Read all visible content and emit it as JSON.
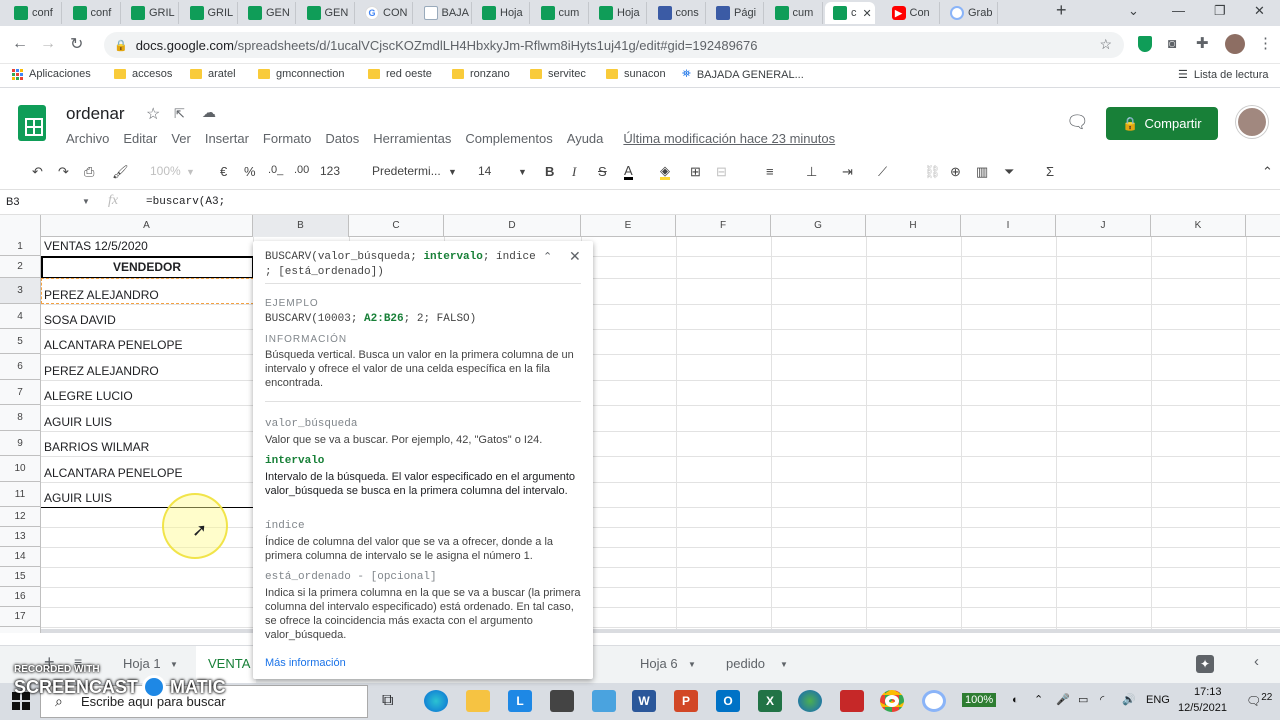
{
  "browser": {
    "tabs": [
      {
        "icon": "sheets",
        "label": "conf"
      },
      {
        "icon": "sheets",
        "label": "conf"
      },
      {
        "icon": "sheets",
        "label": "GRIL"
      },
      {
        "icon": "sheets",
        "label": "GRIL"
      },
      {
        "icon": "sheets",
        "label": "GEN"
      },
      {
        "icon": "sheets",
        "label": "GEN"
      },
      {
        "icon": "google",
        "label": "CON"
      },
      {
        "icon": "bajada",
        "label": "BAJA"
      },
      {
        "icon": "sheets",
        "label": "Hoja"
      },
      {
        "icon": "sheets",
        "label": "cum"
      },
      {
        "icon": "sheets",
        "label": "Hoja"
      },
      {
        "icon": "docs",
        "label": "cons"
      },
      {
        "icon": "docs",
        "label": "Pági"
      },
      {
        "icon": "sheets",
        "label": "cum"
      },
      {
        "icon": "sheets",
        "label": "c"
      },
      {
        "icon": "youtube",
        "label": "Con"
      },
      {
        "icon": "record",
        "label": "Grab"
      }
    ],
    "url_host": "docs.google.com",
    "url_path": "/spreadsheets/d/1ucalVCjscKOZmdlLH4HbxkyJm-Rflwm8iHyts1uj41g/edit#gid=192489676",
    "bookmarks": [
      "Aplicaciones",
      "accesos",
      "aratel",
      "gmconnection",
      "red oeste",
      "ronzano",
      "servitec",
      "sunacon",
      "BAJADA GENERAL...",
      "Lista de lectura"
    ]
  },
  "app": {
    "title": "ordenar",
    "menu": [
      "Archivo",
      "Editar",
      "Ver",
      "Insertar",
      "Formato",
      "Datos",
      "Herramientas",
      "Complementos",
      "Ayuda"
    ],
    "last_edit": "Última modificación hace 23 minutos",
    "share_label": "Compartir",
    "brand_color": "#188038"
  },
  "toolbar": {
    "zoom": "100%",
    "currency": "€",
    "percent": "%",
    "dec_less": ".0_",
    "dec_more": ".00",
    "format_more": "123",
    "font": "Predetermi...",
    "font_size": "14"
  },
  "formula_bar": {
    "cell_ref": "B3",
    "fx": "fx",
    "formula": "=buscarv(A3;"
  },
  "grid": {
    "columns": [
      "A",
      "B",
      "C",
      "D",
      "E",
      "F",
      "G",
      "H",
      "I",
      "J",
      "K"
    ],
    "rows": [
      "1",
      "2",
      "3",
      "4",
      "5",
      "6",
      "7",
      "8",
      "9",
      "10",
      "11",
      "12",
      "13",
      "14",
      "15",
      "16",
      "17"
    ],
    "col_a_values": [
      "VENTAS 12/5/2020",
      "VENDEDOR",
      "PEREZ ALEJANDRO",
      "SOSA DAVID",
      "ALCANTARA PENELOPE",
      "PEREZ ALEJANDRO",
      "ALEGRE LUCIO",
      "AGUIR LUIS",
      "BARRIOS WILMAR",
      "ALCANTARA PENELOPE",
      "AGUIR LUIS"
    ]
  },
  "tooltip": {
    "signature_name": "BUSCARV(",
    "signature_arg1": "valor_búsqueda; ",
    "signature_arg2": "intervalo",
    "signature_rest": "; índice",
    "signature_line2": "; [está_ordenado])",
    "example_label": "EJEMPLO",
    "example_pre": "BUSCARV(10003; ",
    "example_hl": "A2:B26",
    "example_post": "; 2; FALSO)",
    "info_label": "INFORMACIÓN",
    "info_text": "Búsqueda vertical. Busca un valor en la primera columna de un intervalo y ofrece el valor de una celda específica en la fila encontrada.",
    "args": [
      {
        "name": "valor_búsqueda",
        "desc": "Valor que se va a buscar. Por ejemplo, 42, \"Gatos\" o I24."
      },
      {
        "name": "intervalo",
        "desc": "Intervalo de la búsqueda. El valor especificado en el argumento valor_búsqueda se busca en la primera columna del intervalo."
      },
      {
        "name": "índice",
        "desc": "Índice de columna del valor que se va a ofrecer, donde a la primera columna de intervalo se le asigna el número 1."
      },
      {
        "name": "está_ordenado - [opcional]",
        "desc": "Indica si la primera columna en la que se va a buscar (la primera columna del intervalo especificado) está ordenado. En tal caso, se ofrece la coincidencia más exacta con el argumento valor_búsqueda."
      }
    ],
    "more_link": "Más información"
  },
  "sheets_bar": {
    "tabs": [
      "Hoja 1",
      "VENTA",
      "Hoja 6",
      "pedido"
    ],
    "active_tab": "VENTA"
  },
  "taskbar": {
    "search_placeholder": "Escribe aquí para buscar",
    "battery": "100%",
    "language": "ENG",
    "time": "17:13",
    "date": "12/5/2021",
    "notifications": "22"
  },
  "watermark": {
    "line1": "RECORDED WITH",
    "line2": "SCREENCAST",
    "line3": "MATIC"
  }
}
